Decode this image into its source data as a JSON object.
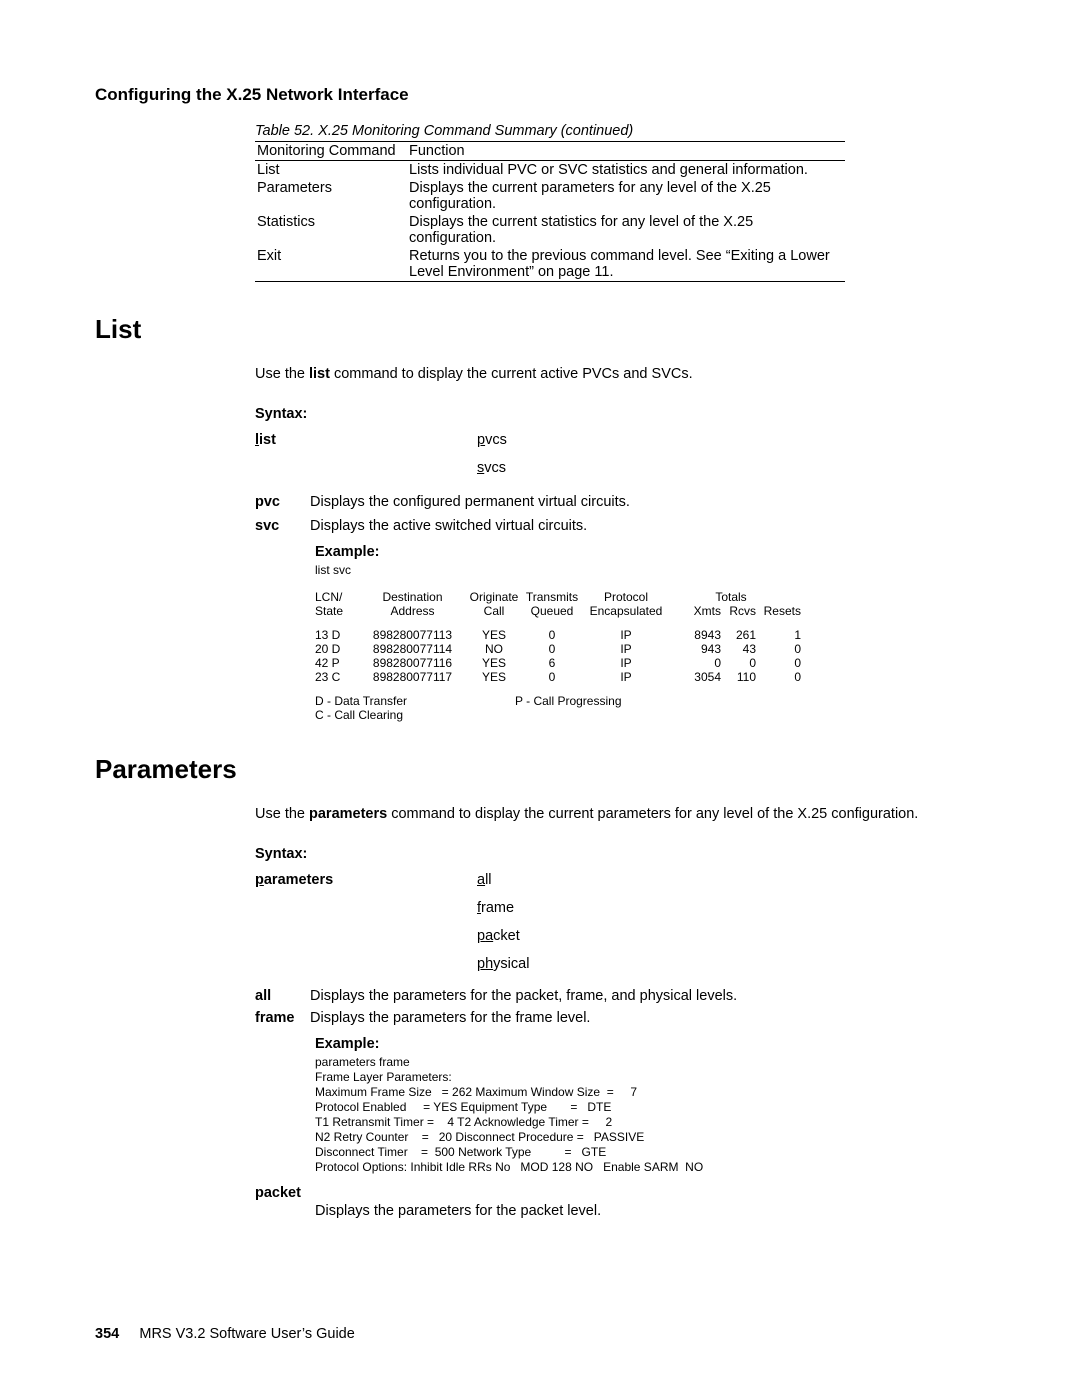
{
  "running_head": "Configuring the X.25 Network Interface",
  "table": {
    "caption": "Table 52. X.25 Monitoring Command Summary  (continued)",
    "head_c1": "Monitoring Command",
    "head_c2": "Function",
    "rows": [
      {
        "c1": "List",
        "c2": "Lists individual PVC or SVC statistics and general information."
      },
      {
        "c1": "Parameters",
        "c2": "Displays the current parameters for any level of the X.25 configuration."
      },
      {
        "c1": "Statistics",
        "c2": "Displays the current statistics for any level of the X.25 configuration."
      },
      {
        "c1": "Exit",
        "c2": "Returns you to the previous command level. See “Exiting a Lower Level Environment” on page 11."
      }
    ]
  },
  "list": {
    "heading": "List",
    "intro_a": "Use the ",
    "intro_b": "list",
    "intro_c": " command to display the current active PVCs and SVCs.",
    "syntax_label": "Syntax:",
    "cmd": "list",
    "opts": [
      "pvcs",
      "svcs"
    ],
    "defs": [
      {
        "term": "pvc",
        "def": "Displays the configured permanent virtual circuits."
      },
      {
        "term": "svc",
        "def": "Displays the active switched virtual circuits."
      }
    ],
    "example_label": "Example:",
    "example_cmd": "list svc",
    "state_headers_top": {
      "lcn": "LCN/",
      "dest": "Destination",
      "orig": "Originate",
      "tx": "Transmits",
      "proto": "Protocol",
      "tot": "Totals"
    },
    "state_headers_bot": {
      "lcn": "State",
      "dest": "Address",
      "orig": "Call",
      "tx": "Queued",
      "proto": "Encapsulated",
      "xmts": "Xmts",
      "rcvs": "Rcvs",
      "rst": "Resets"
    },
    "state_rows": [
      {
        "lcn": "13 D",
        "dest": "898280077113",
        "orig": "YES",
        "tx": "0",
        "proto": "IP",
        "xmts": "8943",
        "rcvs": "261",
        "rst": "1"
      },
      {
        "lcn": "20 D",
        "dest": "898280077114",
        "orig": "NO",
        "tx": "0",
        "proto": "IP",
        "xmts": "943",
        "rcvs": "43",
        "rst": "0"
      },
      {
        "lcn": "42 P",
        "dest": "898280077116",
        "orig": "YES",
        "tx": "6",
        "proto": "IP",
        "xmts": "0",
        "rcvs": "0",
        "rst": "0"
      },
      {
        "lcn": "23 C",
        "dest": "898280077117",
        "orig": "YES",
        "tx": "0",
        "proto": "IP",
        "xmts": "3054",
        "rcvs": "110",
        "rst": "0"
      }
    ],
    "legend": {
      "d": "D   - Data Transfer",
      "p": "P   - Call Progressing",
      "c": "C   - Call Clearing"
    }
  },
  "params": {
    "heading": "Parameters",
    "intro_a": "Use the ",
    "intro_b": "parameters",
    "intro_c": " command to display the current parameters for any level of the X.25 configuration.",
    "syntax_label": "Syntax:",
    "cmd": "parameters",
    "opts": [
      "all",
      "frame",
      "packet",
      "physical"
    ],
    "defs_top": [
      {
        "term": "all",
        "def": "Displays the parameters for the packet, frame, and physical levels."
      },
      {
        "term": "frame",
        "def": "Displays the parameters for the frame level."
      }
    ],
    "example_label": "Example:",
    "frame_example": "parameters frame\nFrame Layer Parameters:\nMaximum Frame Size   = 262 Maximum Window Size  =     7\nProtocol Enabled     = YES Equipment Type       =   DTE\nT1 Retransmit Timer =    4 T2 Acknowledge Timer =     2\nN2 Retry Counter    =   20 Disconnect Procedure =   PASSIVE\nDisconnect Timer    =  500 Network Type          =   GTE\nProtocol Options: Inhibit Idle RRs No   MOD 128 NO   Enable SARM  NO",
    "packet_term": "packet",
    "packet_def": "Displays the parameters for the packet level."
  },
  "footer": {
    "page": "354",
    "text": "MRS V3.2 Software User’s Guide"
  }
}
